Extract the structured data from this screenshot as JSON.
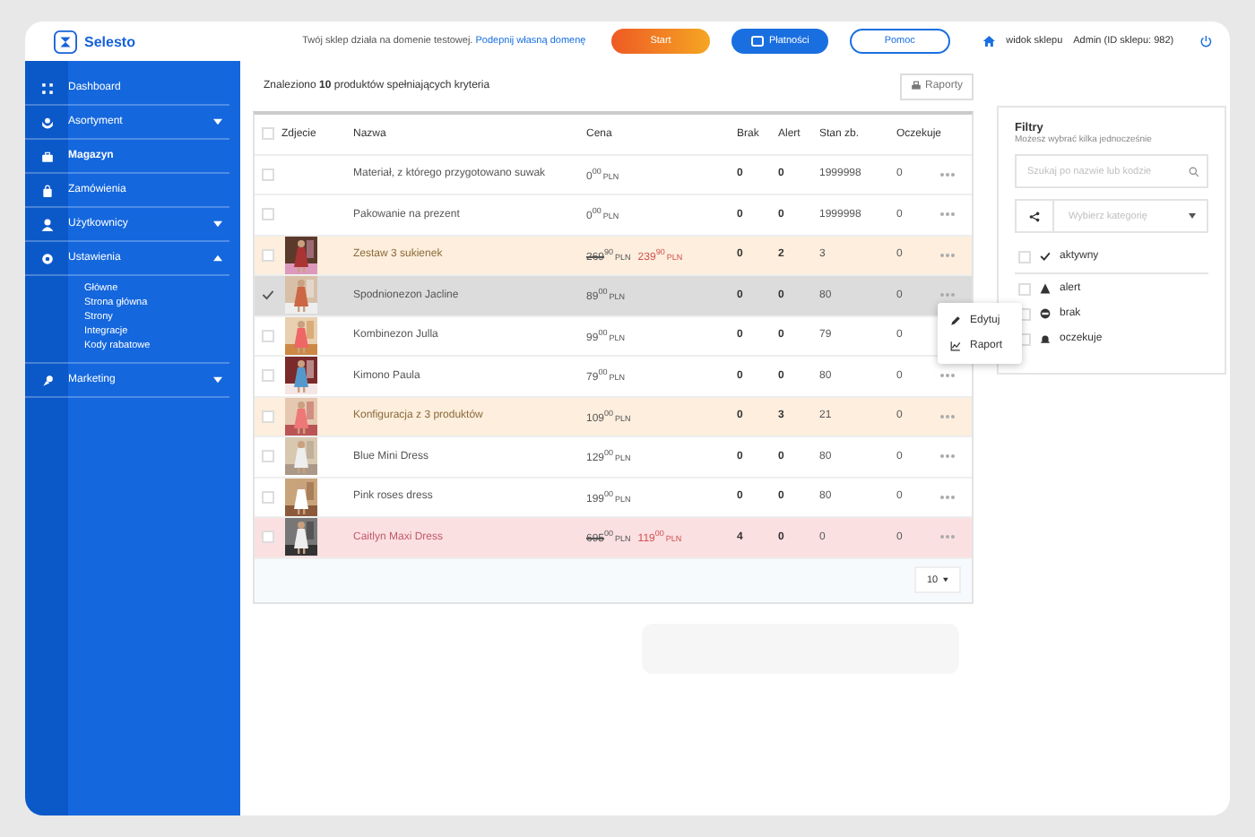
{
  "header": {
    "logo": "Selesto",
    "notice": "Twój sklep działa na domenie testowej.",
    "notice_link": "Podepnij własną domenę",
    "buttons": [
      {
        "label": "Start",
        "kind": "gradient"
      },
      {
        "label": "Płatności",
        "kind": "solid"
      },
      {
        "label": "Pomoc",
        "kind": "outline"
      }
    ],
    "shop_link": "widok sklepu",
    "account": "Admin (ID sklepu: 982)"
  },
  "sidebar": {
    "items": [
      {
        "label": "Dashboard",
        "kind": "link",
        "selected": false
      },
      {
        "label": "Asortyment",
        "kind": "group",
        "selected": false,
        "expanded": false
      },
      {
        "label": "Magazyn",
        "kind": "link",
        "selected": true
      },
      {
        "label": "Zamówienia",
        "kind": "link",
        "selected": false
      },
      {
        "label": "Użytkownicy",
        "kind": "group",
        "selected": false,
        "expanded": false
      },
      {
        "label": "Ustawienia",
        "kind": "group",
        "selected": false,
        "expanded": true,
        "children": [
          "Główne",
          "Strona główna",
          "Strony",
          "Integracje",
          "Kody rabatowe"
        ]
      },
      {
        "label": "Marketing",
        "kind": "group",
        "selected": false,
        "expanded": false
      }
    ]
  },
  "summary": {
    "before": "Znaleziono ",
    "count": "10",
    "after": " produktów spełniających kryteria"
  },
  "reports_button": "Raporty",
  "table": {
    "all_checked": false,
    "columns": [
      "Zdjecie",
      "Nazwa",
      "Cena",
      "Brak",
      "Alert",
      "Stan zb.",
      "Oczekuje"
    ],
    "rows": [
      {
        "checked": false,
        "selected": false,
        "kind": "normal",
        "photo": false,
        "name": "Materiał, z którego przygotowano suwak",
        "price": {
          "amount": "0",
          "cents": "00",
          "currency": "PLN"
        },
        "missing": "0",
        "alert": "0",
        "stock": "1999998",
        "waiting": "0"
      },
      {
        "checked": false,
        "selected": false,
        "kind": "normal",
        "photo": false,
        "name": "Pakowanie na prezent",
        "price": {
          "amount": "0",
          "cents": "00",
          "currency": "PLN"
        },
        "missing": "0",
        "alert": "0",
        "stock": "1999998",
        "waiting": "0"
      },
      {
        "checked": false,
        "selected": false,
        "kind": "warning",
        "photo": true,
        "name": "Zestaw 3 sukienek",
        "old_price": {
          "amount": "269",
          "cents": "90",
          "currency": "PLN"
        },
        "price": {
          "amount": "239",
          "cents": "90",
          "currency": "PLN"
        },
        "missing": "0",
        "alert": "2",
        "stock": "3",
        "waiting": "0"
      },
      {
        "checked": true,
        "selected": true,
        "kind": "normal",
        "photo": true,
        "name": "Spodnionezon Jacline",
        "menu": [
          "Edytuj",
          "Raport"
        ],
        "price": {
          "amount": "89",
          "cents": "00",
          "currency": "PLN"
        },
        "missing": "0",
        "alert": "0",
        "stock": "80",
        "waiting": "0"
      },
      {
        "checked": false,
        "selected": false,
        "kind": "normal",
        "photo": true,
        "name": "Kombinezon Julla",
        "price": {
          "amount": "99",
          "cents": "00",
          "currency": "PLN"
        },
        "missing": "0",
        "alert": "0",
        "stock": "79",
        "waiting": "0"
      },
      {
        "checked": false,
        "selected": false,
        "kind": "normal",
        "photo": true,
        "name": "Kimono Paula",
        "price": {
          "amount": "79",
          "cents": "00",
          "currency": "PLN"
        },
        "missing": "0",
        "alert": "0",
        "stock": "80",
        "waiting": "0"
      },
      {
        "checked": false,
        "selected": false,
        "kind": "warning",
        "photo": true,
        "name": "Konfiguracja z 3 produktów",
        "price": {
          "amount": "109",
          "cents": "00",
          "currency": "PLN"
        },
        "missing": "0",
        "alert": "3",
        "stock": "21",
        "waiting": "0"
      },
      {
        "checked": false,
        "selected": false,
        "kind": "normal",
        "photo": true,
        "name": "Blue Mini Dress",
        "price": {
          "amount": "129",
          "cents": "00",
          "currency": "PLN"
        },
        "missing": "0",
        "alert": "0",
        "stock": "80",
        "waiting": "0"
      },
      {
        "checked": false,
        "selected": false,
        "kind": "normal",
        "photo": true,
        "name": "Pink roses dress",
        "price": {
          "amount": "199",
          "cents": "00",
          "currency": "PLN"
        },
        "missing": "0",
        "alert": "0",
        "stock": "80",
        "waiting": "0"
      },
      {
        "checked": false,
        "selected": false,
        "kind": "danger",
        "photo": true,
        "name": "Caitlyn Maxi Dress",
        "old_price": {
          "amount": "695",
          "cents": "00",
          "currency": "PLN"
        },
        "price": {
          "amount": "119",
          "cents": "00",
          "currency": "PLN"
        },
        "missing": "4",
        "alert": "0",
        "stock": "0",
        "waiting": "0"
      }
    ],
    "page_size": "10"
  },
  "filters": {
    "title": "Filtry",
    "subtitle": "Możesz wybrać kilka jednocześnie",
    "search": {
      "placeholder": "Szukaj po nazwie lub kodzie"
    },
    "category": {
      "placeholder": "Wybierz kategorię"
    },
    "options": [
      {
        "label": "aktywny",
        "checked": false
      },
      {
        "label": "alert",
        "checked": false
      },
      {
        "label": "brak",
        "checked": false
      },
      {
        "label": "oczekuje",
        "checked": false
      }
    ]
  }
}
